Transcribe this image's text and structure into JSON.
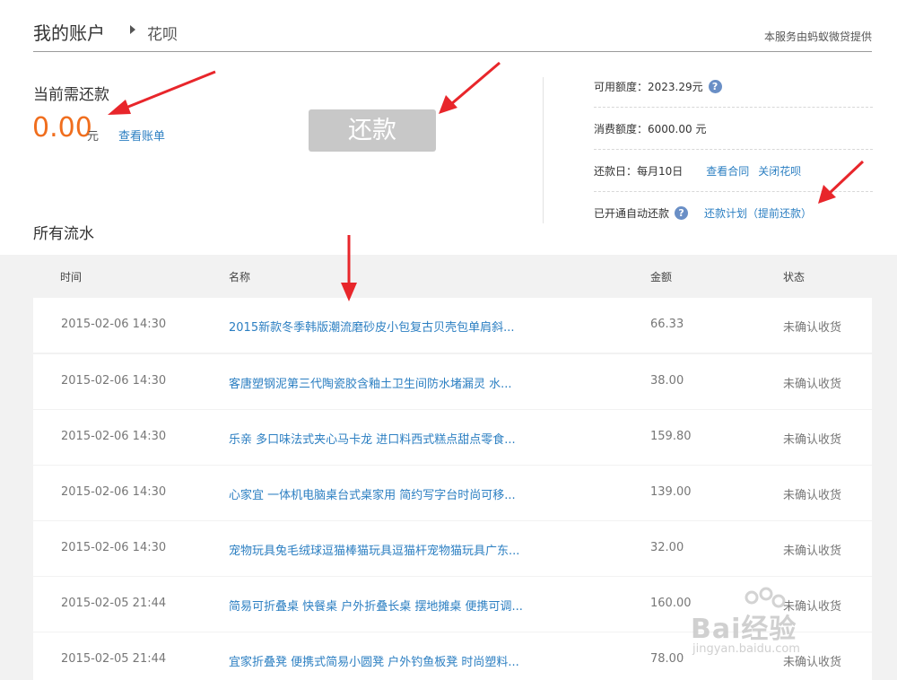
{
  "header": {
    "title": "我的账户",
    "crumb": "花呗",
    "provider": "本服务由蚂蚁微贷提供"
  },
  "due": {
    "label": "当前需还款",
    "amount": "0.00",
    "unit": "元",
    "view_bill": "查看账单",
    "repay_button": "还款"
  },
  "info": {
    "available_label": "可用额度：2023.29元",
    "limit_label": "消费额度：6000.00 元",
    "repay_day_label": "还款日：每月10日",
    "view_contract": "查看合同",
    "close_huabei": "关闭花呗",
    "auto_repay_label": "已开通自动还款",
    "repay_plan": "还款计划",
    "prepay": "（提前还款）"
  },
  "flow": {
    "title": "所有流水",
    "columns": [
      "时间",
      "名称",
      "金额",
      "状态"
    ],
    "rows": [
      {
        "time": "2015-02-06 14:30",
        "name": "2015新款冬季韩版潮流磨砂皮小包复古贝壳包单肩斜...",
        "amount": "66.33",
        "status": "未确认收货"
      },
      {
        "time": "2015-02-06 14:30",
        "name": "客唐塑钢泥第三代陶瓷胶含釉土卫生间防水堵漏灵 水...",
        "amount": "38.00",
        "status": "未确认收货"
      },
      {
        "time": "2015-02-06 14:30",
        "name": "乐亲 多口味法式夹心马卡龙 进口料西式糕点甜点零食...",
        "amount": "159.80",
        "status": "未确认收货"
      },
      {
        "time": "2015-02-06 14:30",
        "name": "心家宜 一体机电脑桌台式桌家用 简约写字台时尚可移...",
        "amount": "139.00",
        "status": "未确认收货"
      },
      {
        "time": "2015-02-06 14:30",
        "name": "宠物玩具兔毛绒球逗猫棒猫玩具逗猫杆宠物猫玩具广东...",
        "amount": "32.00",
        "status": "未确认收货"
      },
      {
        "time": "2015-02-05 21:44",
        "name": "简易可折叠桌 快餐桌 户外折叠长桌 摆地摊桌 便携可调...",
        "amount": "160.00",
        "status": "未确认收货"
      },
      {
        "time": "2015-02-05 21:44",
        "name": "宜家折叠凳 便携式简易小圆凳 户外钓鱼板凳 时尚塑料...",
        "amount": "78.00",
        "status": "未确认收货"
      }
    ]
  },
  "watermark": {
    "text": "Bai经验",
    "sub": "jingyan.baidu.com"
  },
  "colors": {
    "accent_orange": "#f06e1e",
    "link_blue": "#2c7fc2",
    "annotation_red": "#e8262b"
  }
}
